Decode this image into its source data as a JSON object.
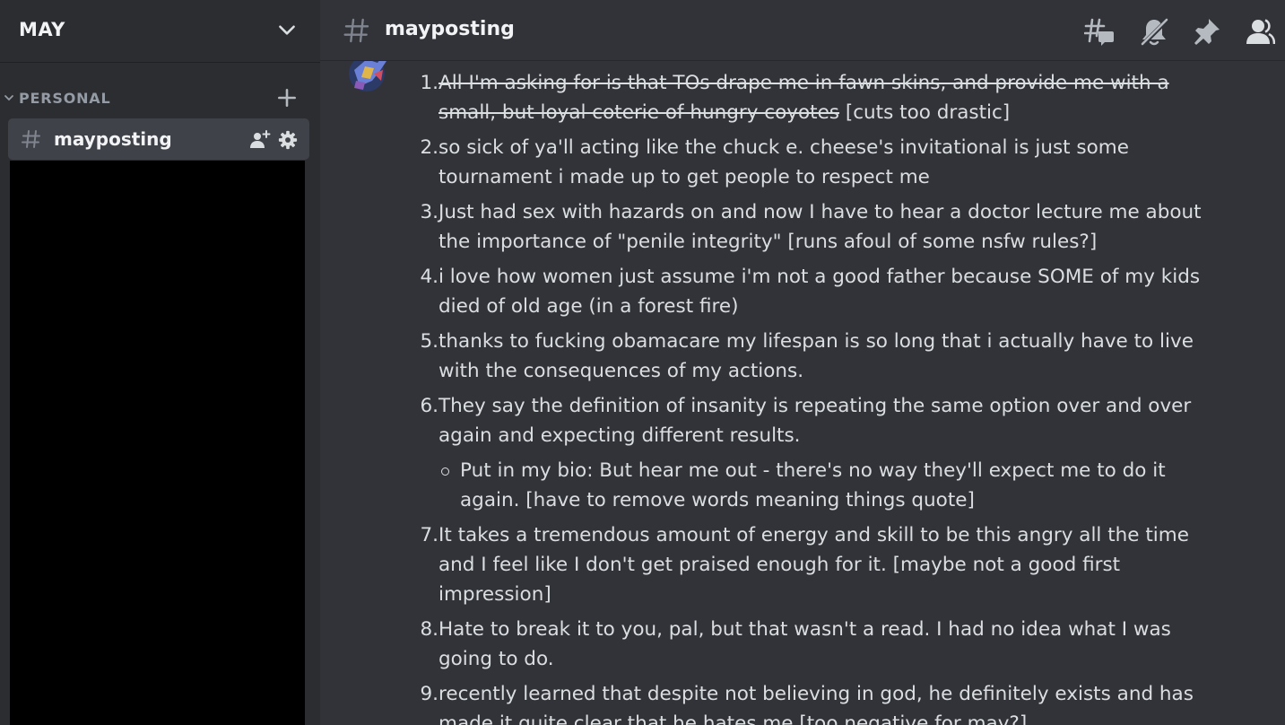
{
  "server": {
    "name": "MAY"
  },
  "sidebar": {
    "category": "PERSONAL",
    "channel": {
      "name": "mayposting"
    }
  },
  "header": {
    "channel_name": "mayposting"
  },
  "icons": {
    "server_menu": "chevron-down-icon",
    "add_channel": "plus-icon",
    "invite": "add-member-icon",
    "settings": "gear-icon",
    "threads": "threads-icon",
    "mute": "bell-slash-icon",
    "pin": "pin-icon",
    "members": "members-icon"
  },
  "colors": {
    "background": "#313338",
    "sidebar": "#2b2d31",
    "selected_channel": "#404249",
    "text": "#dbdee1"
  },
  "message": {
    "items": [
      {
        "number": "1.",
        "struck": "All I'm asking for is that TOs drape me in fawn skins, and provide me with a small, but loyal coterie of hungry coyotes",
        "note": " [cuts too drastic]"
      },
      {
        "number": "2.",
        "text": "so sick of ya'll acting like the chuck e. cheese's invitational is just some tournament i made up to get people to respect me"
      },
      {
        "number": "3.",
        "text": "Just had sex with hazards on and now I have to hear a doctor lecture me about the importance of \"penile integrity\" [runs afoul of some nsfw rules?]"
      },
      {
        "number": "4.",
        "text": "i love how women just assume i'm not a good father because SOME of my kids died of old age (in a forest fire)"
      },
      {
        "number": "5.",
        "text": "thanks to fucking obamacare my lifespan is so long that i actually have to live with the consequences of my actions."
      },
      {
        "number": "6.",
        "text": "They say the definition of insanity is repeating the same option over and over again and expecting different results.",
        "sub": "Put in my bio: But hear me out - there's no way they'll expect me to do it again. [have to remove words meaning things quote]"
      },
      {
        "number": "7.",
        "text": "It takes a tremendous amount of energy and skill to be this angry all the time and I feel like I don't get praised enough for it. [maybe not a good first impression]"
      },
      {
        "number": "8.",
        "text": "Hate to break it to you, pal, but that wasn't a read. I had no idea what I was going to do."
      },
      {
        "number": "9.",
        "text": "recently learned that despite not believing in god, he definitely exists and has made it quite clear that he hates me [too negative for may?]"
      }
    ]
  }
}
